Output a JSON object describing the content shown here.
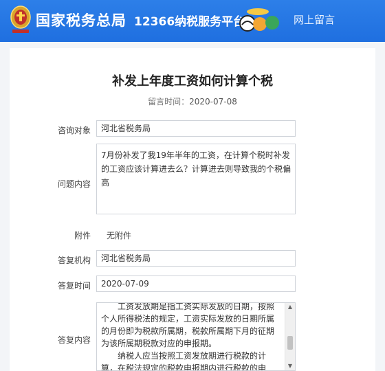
{
  "header": {
    "brand": "国家税务总局",
    "platform": "12366纳税服务平台",
    "nav_link": "网上留言"
  },
  "page": {
    "title": "补发上年度工资如何计算个税",
    "date_label": "留言时间：",
    "date_value": "2020-07-08"
  },
  "form": {
    "consult_target_label": "咨询对象",
    "consult_target_value": "河北省税务局",
    "question_label": "问题内容",
    "question_value": "7月份补发了我19年半年的工资，在计算个税时补发的工资应该计算进去么？计算进去则导致我的个税偏高",
    "attachment_label": "附件",
    "attachment_value": "无附件",
    "reply_org_label": "答复机构",
    "reply_org_value": "河北省税务局",
    "reply_time_label": "答复时间",
    "reply_time_value": "2020-07-09",
    "reply_content_label": "答复内容",
    "reply_paragraph_1": "工资发放期是指工资实际发放的日期，按照个人所得税法的规定，工资实际发放的日期所属的月份即为税款所属期，税款所属期下月的征期为该所属期税款对应的申报期。",
    "reply_paragraph_2": "纳税人应当按照工资发放期进行税款的计算，在税法规定的税款申报期内进行税款的申报。"
  },
  "icons": {
    "emblem": "tax-emblem-icon",
    "mascot": "mascot-logo-icon"
  },
  "colors": {
    "header_blue": "#2272e4",
    "field_border": "#cfd3d9"
  }
}
